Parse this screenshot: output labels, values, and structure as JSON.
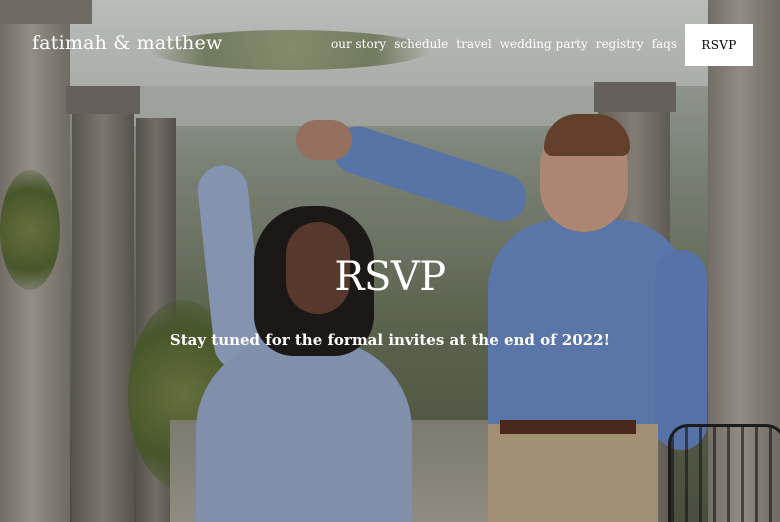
{
  "header": {
    "site_title": "fatimah & matthew",
    "nav_items": [
      {
        "label": "our story"
      },
      {
        "label": "schedule"
      },
      {
        "label": "travel"
      },
      {
        "label": "wedding party"
      },
      {
        "label": "registry"
      },
      {
        "label": "faqs"
      }
    ],
    "cta_label": "RSVP"
  },
  "hero": {
    "heading": "RSVP",
    "subtext": "Stay tuned for the formal invites at the end of 2022!"
  },
  "colors": {
    "text": "#ffffff",
    "button_bg": "#ffffff",
    "button_text": "#000000"
  }
}
